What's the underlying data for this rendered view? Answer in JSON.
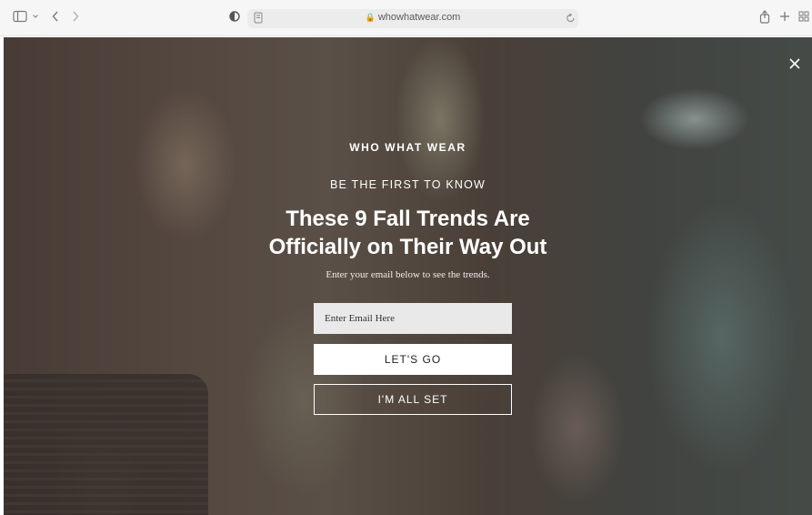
{
  "browser": {
    "url": "whowhatwear.com",
    "icons": {
      "sidebar": "sidebar-icon",
      "back": "chevron-left-icon",
      "forward": "chevron-right-icon",
      "privacy": "shield-icon",
      "reader": "page-icon",
      "lock": "lock-icon",
      "reload": "reload-icon",
      "share": "share-icon",
      "new_tab": "plus-icon",
      "tabs": "tab-grid-icon"
    }
  },
  "modal": {
    "brand": "WHO WHAT WEAR",
    "eyebrow": "BE THE FIRST TO KNOW",
    "headline_line1": "These 9 Fall Trends Are",
    "headline_line2": "Officially on Their Way Out",
    "subtext": "Enter your email below to see the trends.",
    "email_placeholder": "Enter Email Here",
    "submit_label": "LET'S GO",
    "dismiss_label": "I'M ALL SET",
    "close_icon": "close-icon"
  },
  "colors": {
    "overlay_text": "#ffffff",
    "input_bg": "#e9e9e9",
    "primary_button_bg": "#ffffff"
  }
}
